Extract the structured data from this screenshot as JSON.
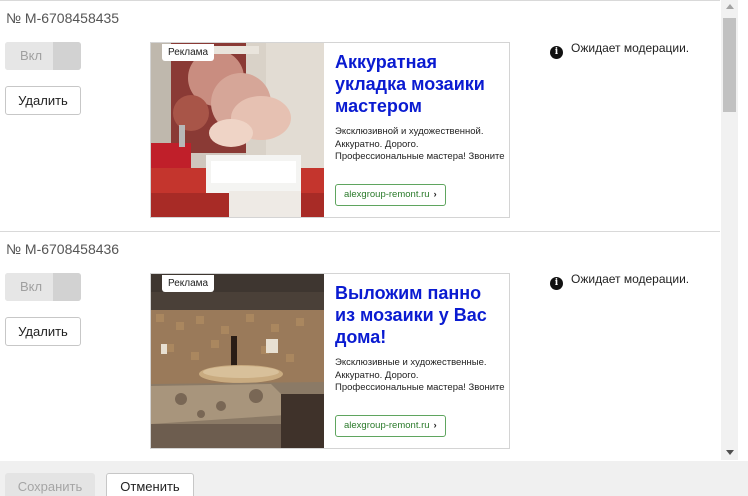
{
  "ads": [
    {
      "number": "№ M-6708458435",
      "toggle_label": "Вкл",
      "delete_label": "Удалить",
      "badge": "Реклама",
      "title": "Аккуратная укладка мозаики мастером",
      "text": "Эксклюзивной и художественной. Аккуратно. Дорого. Профессиональные мастера! Звоните",
      "link": "alexgroup-remont.ru",
      "status": "Ожидает модерации.",
      "image": "bathroom-mosaic-photo"
    },
    {
      "number": "№ M-6708458436",
      "toggle_label": "Вкл",
      "delete_label": "Удалить",
      "badge": "Реклама",
      "title": "Выложим панно из мозаики у Вас дома!",
      "text": "Эксклюзивные и художественные. Аккуратно. Дорого. Профессиональные мастера! Звоните",
      "link": "alexgroup-remont.ru",
      "status": "Ожидает модерации.",
      "image": "kitchen-mosaic-photo"
    }
  ],
  "footer": {
    "save_label": "Сохранить",
    "cancel_label": "Отменить"
  },
  "icons": {
    "info": "info-icon",
    "chevron": "chevron-right-icon"
  },
  "colors": {
    "ad_title": "#0a1bd1",
    "link_border": "#5fa55f",
    "link_text": "#2a7a2a"
  }
}
